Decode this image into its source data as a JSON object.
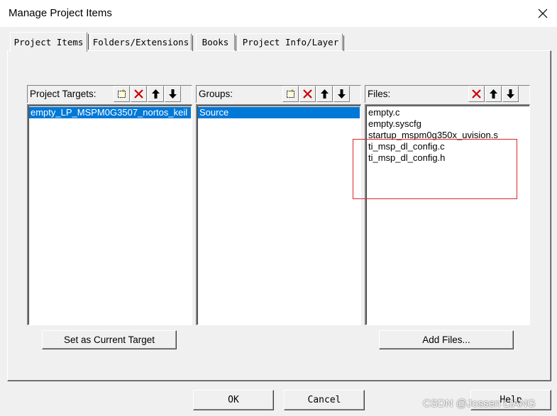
{
  "window": {
    "title": "Manage Project Items"
  },
  "tabs": [
    {
      "label": "Project Items",
      "active": true
    },
    {
      "label": "Folders/Extensions",
      "active": false
    },
    {
      "label": "Books",
      "active": false
    },
    {
      "label": "Project Info/Layer",
      "active": false
    }
  ],
  "targets": {
    "label": "Project Targets:",
    "items": [
      "empty_LP_MSPM0G3507_nortos_keil"
    ],
    "selected_index": 0,
    "buttons": [
      "new-icon",
      "delete-icon",
      "move-up-icon",
      "move-down-icon"
    ]
  },
  "groups": {
    "label": "Groups:",
    "items": [
      "Source"
    ],
    "selected_index": 0,
    "buttons": [
      "new-icon",
      "delete-icon",
      "move-up-icon",
      "move-down-icon"
    ]
  },
  "files": {
    "label": "Files:",
    "items": [
      "empty.c",
      "empty.syscfg",
      "startup_mspm0g350x_uvision.s",
      "ti_msp_dl_config.c",
      "ti_msp_dl_config.h"
    ],
    "buttons": [
      "delete-icon",
      "move-up-icon",
      "move-down-icon"
    ]
  },
  "actions": {
    "set_current_target": "Set as Current Target",
    "add_files": "Add Files..."
  },
  "dialog_buttons": {
    "ok": "OK",
    "cancel": "Cancel",
    "help": "Help"
  },
  "watermark": "CSDN @Jossen LIANG",
  "colors": {
    "selection": "#0078d7",
    "highlight_box": "#d9262c",
    "delete_icon": "#cc0000"
  }
}
